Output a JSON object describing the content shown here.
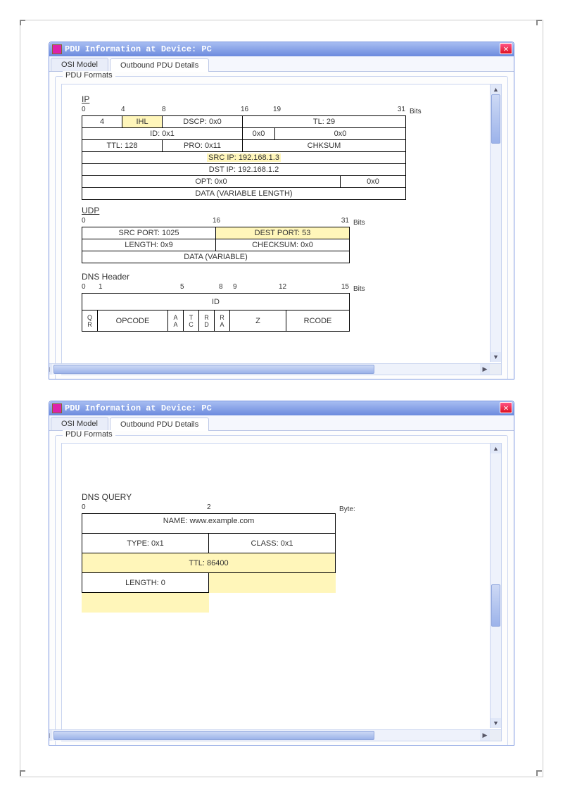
{
  "window_title": "PDU Information at Device: PC",
  "tabs": {
    "osi": "OSI Model",
    "outbound": "Outbound PDU Details"
  },
  "fieldset_legend": "PDU Formats",
  "bits_label": "Bits",
  "byte_label": "Byte:",
  "ip": {
    "label": "IP",
    "ruler": [
      "0",
      "4",
      "8",
      "16",
      "19",
      "31"
    ],
    "version": "4",
    "ihl": "IHL",
    "dscp": "DSCP: 0x0",
    "tl": "TL: 29",
    "ident": "ID: 0x1",
    "flags": "0x0",
    "frag": "0x0",
    "ttl": "TTL: 128",
    "proto": "PRO: 0x11",
    "chksum": "CHKSUM",
    "src": "SRC IP: 192.168.1.3",
    "dst": "DST IP: 192.168.1.2",
    "opt": "OPT: 0x0",
    "pad": "0x0",
    "data": "DATA (VARIABLE LENGTH)"
  },
  "udp": {
    "label": "UDP",
    "ruler": [
      "0",
      "16",
      "31"
    ],
    "src_port": "SRC PORT: 1025",
    "dst_port": "DEST PORT: 53",
    "length": "LENGTH: 0x9",
    "checksum": "CHECKSUM: 0x0",
    "data": "DATA (VARIABLE)"
  },
  "dns_header": {
    "label": "DNS Header",
    "ruler": [
      "0",
      "1",
      "5",
      "8",
      "9",
      "12",
      "15"
    ],
    "id": "ID",
    "qr": "QR",
    "opcode": "OPCODE",
    "aa": "AA",
    "tc": "TC",
    "rd": "RD",
    "ra": "RA",
    "z": "Z",
    "rcode": "RCODE"
  },
  "dns_query": {
    "label": "DNS QUERY",
    "ruler": [
      "0",
      "2"
    ],
    "name": "NAME: www.example.com",
    "type": "TYPE: 0x1",
    "class": "CLASS: 0x1",
    "ttl": "TTL: 86400",
    "length": "LENGTH: 0"
  }
}
